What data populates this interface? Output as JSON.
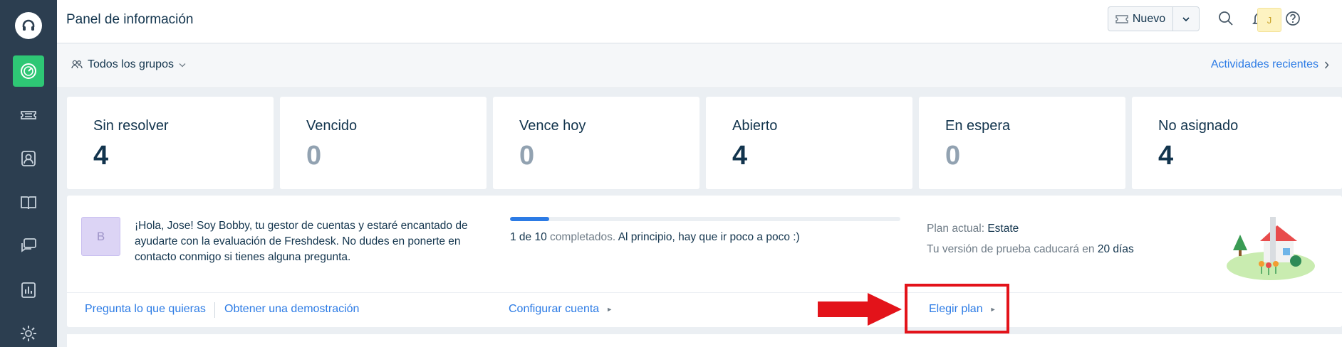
{
  "sidebar": {
    "items": [
      {
        "name": "dashboard",
        "active": true
      },
      {
        "name": "tickets",
        "active": false
      },
      {
        "name": "contacts",
        "active": false
      },
      {
        "name": "solutions",
        "active": false
      },
      {
        "name": "forums",
        "active": false
      },
      {
        "name": "reports",
        "active": false
      },
      {
        "name": "admin",
        "active": false
      }
    ]
  },
  "header": {
    "title": "Panel de información",
    "new_label": "Nuevo",
    "avatar_initial": "J"
  },
  "subbar": {
    "group_filter": "Todos los grupos",
    "recent_link": "Actividades recientes"
  },
  "stats": [
    {
      "label": "Sin resolver",
      "value": "4"
    },
    {
      "label": "Vencido",
      "value": "0"
    },
    {
      "label": "Vence hoy",
      "value": "0"
    },
    {
      "label": "Abierto",
      "value": "4"
    },
    {
      "label": "En espera",
      "value": "0"
    },
    {
      "label": "No asignado",
      "value": "4"
    }
  ],
  "onboarding": {
    "bot_initial": "B",
    "greeting": "¡Hola, Jose! Soy Bobby, tu gestor de cuentas y estaré encantado de ayudarte con la evaluación de Freshdesk. No dudes en ponerte en contacto conmigo si tienes alguna pregunta.",
    "progress_done": "1 de 10",
    "progress_word": "completados.",
    "progress_tail": "Al principio, hay que ir poco a poco :)",
    "progress_fraction": 0.1,
    "plan_label": "Plan actual:",
    "plan_name": "Estate",
    "trial_text": "Tu versión de prueba caducará en",
    "trial_days": "20 días",
    "links": {
      "ask": "Pregunta lo que quieras",
      "demo": "Obtener una demostración",
      "setup": "Configurar cuenta",
      "choose_plan": "Elegir plan"
    }
  },
  "colors": {
    "sidebar": "#2c3e50",
    "active": "#2ec775",
    "link": "#2c7be5",
    "annotation": "#e3131a"
  }
}
